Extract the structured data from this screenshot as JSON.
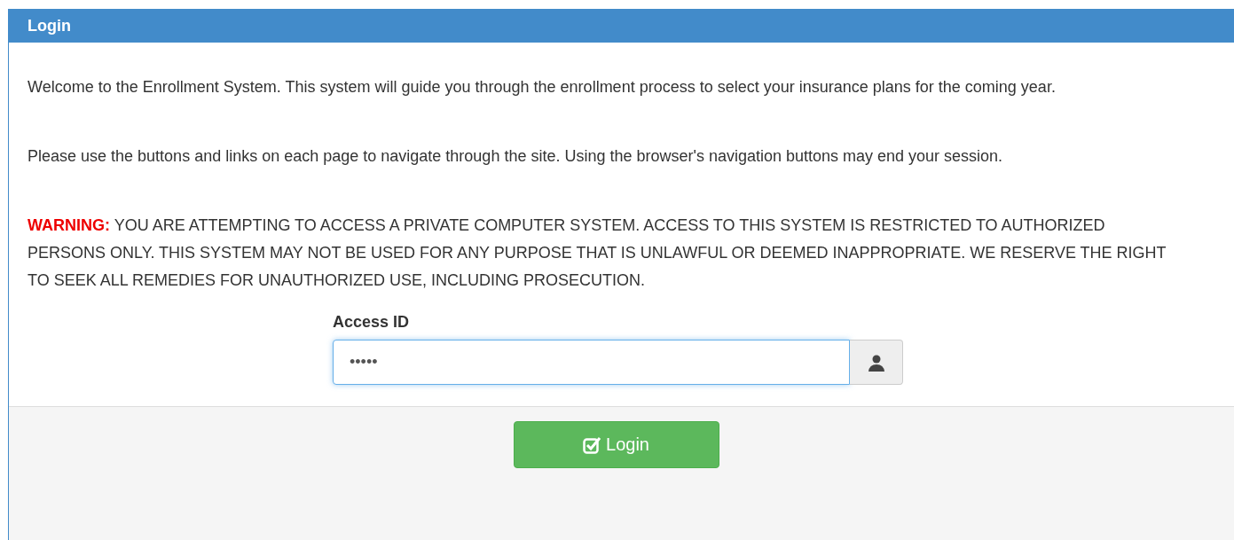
{
  "panel": {
    "title": "Login"
  },
  "paragraphs": [
    "Welcome to the Enrollment System. This system will guide you through the enrollment process to select your insurance plans for the coming year.",
    "Please use the buttons and links on each page to navigate through the site. Using the browser's navigation buttons may end your session."
  ],
  "warning": {
    "label": "WARNING:",
    "text": "YOU ARE ATTEMPTING TO ACCESS A PRIVATE COMPUTER SYSTEM. ACCESS TO THIS SYSTEM IS RESTRICTED TO AUTHORIZED PERSONS ONLY. THIS SYSTEM MAY NOT BE USED FOR ANY PURPOSE THAT IS UNLAWFUL OR DEEMED INAPPROPRIATE. WE RESERVE THE RIGHT TO SEEK ALL REMEDIES FOR UNAUTHORIZED USE, INCLUDING PROSECUTION."
  },
  "access_field": {
    "label": "Access ID",
    "value": "•••••",
    "focused": true
  },
  "login_button": {
    "label": "Login"
  }
}
